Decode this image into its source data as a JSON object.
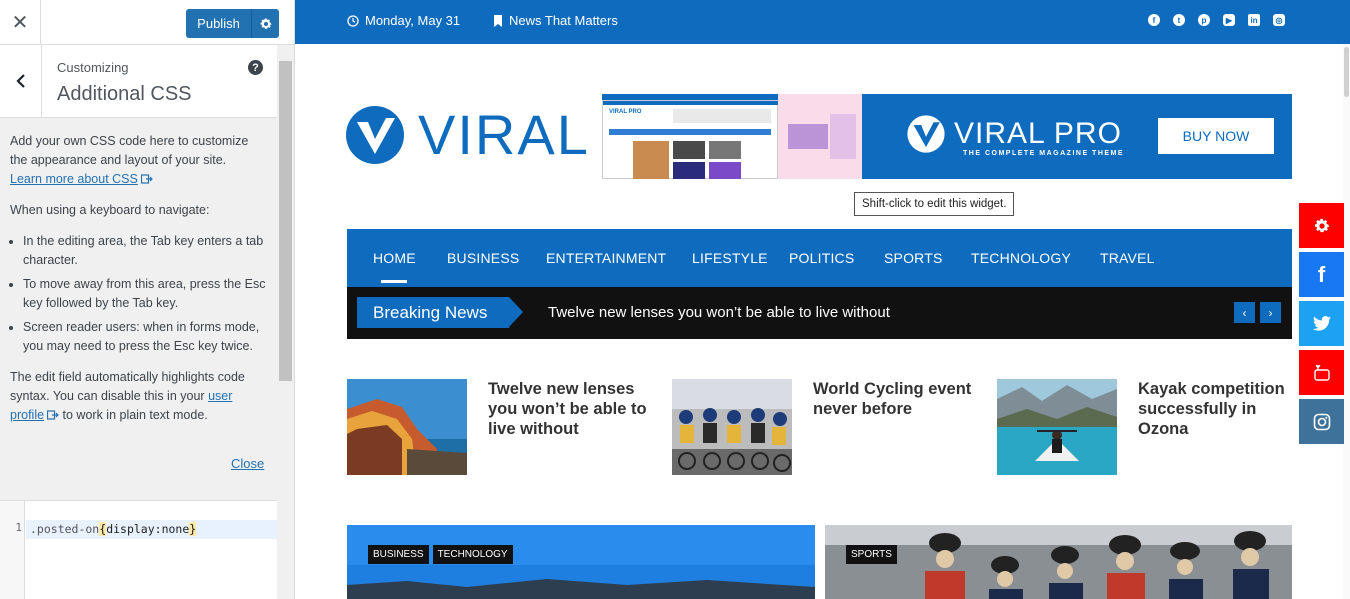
{
  "customizer": {
    "publish_label": "Publish",
    "breadcrumb": "Customizing",
    "panel_title": "Additional CSS",
    "description": {
      "intro": "Add your own CSS code here to customize the appearance and layout of your site.",
      "learn_more": "Learn more about CSS",
      "keyboard_intro": "When using a keyboard to navigate:",
      "bullets": [
        "In the editing area, the Tab key enters a tab character.",
        "To move away from this area, press the Esc key followed by the Tab key.",
        "Screen reader users: when in forms mode, you may need to press the Esc key twice."
      ],
      "highlight_pre": "The edit field automatically highlights code syntax. You can disable this in your",
      "user_profile": "user profile",
      "highlight_post": "to work in plain text mode."
    },
    "close_link": "Close",
    "code": {
      "line_number": "1",
      "selector": ".posted-on",
      "open_brace": "{",
      "declaration": "display:none",
      "close_brace": "}"
    }
  },
  "site": {
    "topbar": {
      "date": "Monday, May 31",
      "tagline": "News That Matters",
      "social": [
        "facebook-icon",
        "twitter-icon",
        "pinterest-icon",
        "youtube-icon",
        "linkedin-icon",
        "instagram-icon"
      ]
    },
    "logo_text": "VIRAL",
    "ad": {
      "brand": "VIRAL PRO",
      "tagline": "THE COMPLETE MAGAZINE THEME",
      "cta": "BUY NOW",
      "shot_label": "VIRAL PRO"
    },
    "tooltip": "Shift-click to edit this widget.",
    "nav": [
      "HOME",
      "BUSINESS",
      "ENTERTAINMENT",
      "LIFESTYLE",
      "POLITICS",
      "SPORTS",
      "TECHNOLOGY",
      "TRAVEL"
    ],
    "breaking": {
      "label": "Breaking News",
      "headline": "Twelve new lenses you won’t be able to live without"
    },
    "posts": [
      {
        "title": "Twelve new lenses you won’t be able to live without"
      },
      {
        "title": "World Cycling event never before"
      },
      {
        "title": "Kayak competition successfully in Ozona"
      }
    ],
    "features": [
      {
        "tags": [
          "BUSINESS",
          "TECHNOLOGY"
        ]
      },
      {
        "tags": [
          "SPORTS"
        ]
      }
    ]
  },
  "colors": {
    "brand_blue": "#0e6bbd",
    "wp_blue": "#2271b1",
    "share_red": "#ff0000",
    "share_facebook": "#1877f2",
    "share_twitter": "#1da1f2",
    "share_instagram": "#3f729b"
  }
}
